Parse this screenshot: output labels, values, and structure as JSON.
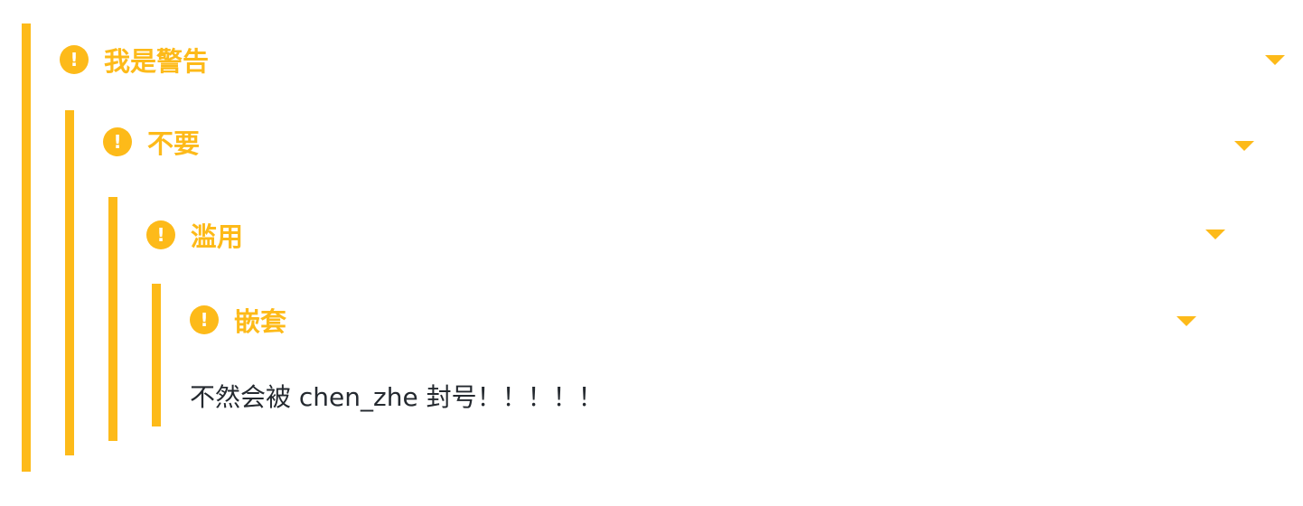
{
  "callouts": [
    {
      "title": "我是警告",
      "icon": "exclamation-circle-icon",
      "collapse_icon": "caret-down-icon"
    },
    {
      "title": "不要",
      "icon": "exclamation-circle-icon",
      "collapse_icon": "caret-down-icon"
    },
    {
      "title": "滥用",
      "icon": "exclamation-circle-icon",
      "collapse_icon": "caret-down-icon"
    },
    {
      "title": "嵌套",
      "icon": "exclamation-circle-icon",
      "collapse_icon": "caret-down-icon"
    }
  ],
  "content": "不然会被 chen_zhe 封号！！！！！",
  "icon_glyph": "!",
  "colors": {
    "accent": "#FDBA19",
    "text": "#24292f"
  }
}
